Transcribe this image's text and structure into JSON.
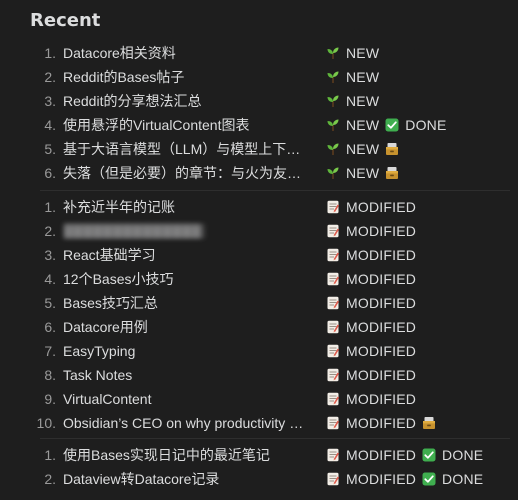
{
  "page": {
    "title": "Recent"
  },
  "tags": {
    "new": "NEW",
    "done": "DONE",
    "modified": "MODIFIED"
  },
  "groups": [
    [
      {
        "num": "1.",
        "name": "Datacore相关资料",
        "tags": [
          "new"
        ]
      },
      {
        "num": "2.",
        "name": "Reddit的Bases帖子",
        "tags": [
          "new"
        ]
      },
      {
        "num": "3.",
        "name": "Reddit的分享想法汇总",
        "tags": [
          "new"
        ]
      },
      {
        "num": "4.",
        "name": "使用悬浮的VirtualContent图表",
        "tags": [
          "new",
          "done"
        ]
      },
      {
        "num": "5.",
        "name": "基于大语言模型（LLM）与模型上下文协议",
        "tags": [
          "new",
          "archive"
        ]
      },
      {
        "num": "6.",
        "name": "失落（但是必要）的章节：与火为友，以及……",
        "tags": [
          "new",
          "archive"
        ]
      }
    ],
    [
      {
        "num": "1.",
        "name": "补充近半年的记账",
        "tags": [
          "modified"
        ]
      },
      {
        "num": "2.",
        "name": "",
        "tags": [
          "modified"
        ],
        "blurred": true
      },
      {
        "num": "3.",
        "name": "React基础学习",
        "tags": [
          "modified"
        ]
      },
      {
        "num": "4.",
        "name": "12个Bases小技巧",
        "tags": [
          "modified"
        ]
      },
      {
        "num": "5.",
        "name": "Bases技巧汇总",
        "tags": [
          "modified"
        ]
      },
      {
        "num": "6.",
        "name": "Datacore用例",
        "tags": [
          "modified"
        ]
      },
      {
        "num": "7.",
        "name": "EasyTyping",
        "tags": [
          "modified"
        ]
      },
      {
        "num": "8.",
        "name": "Task Notes",
        "tags": [
          "modified"
        ]
      },
      {
        "num": "9.",
        "name": "VirtualContent",
        "tags": [
          "modified"
        ]
      },
      {
        "num": "10.",
        "name": "Obsidian’s CEO on why productivity tools",
        "tags": [
          "modified",
          "archive"
        ]
      }
    ],
    [
      {
        "num": "1.",
        "name": "使用Bases实现日记中的最近笔记",
        "tags": [
          "modified",
          "done"
        ]
      },
      {
        "num": "2.",
        "name": "Dataview转Datacore记录",
        "tags": [
          "modified",
          "done"
        ]
      }
    ]
  ]
}
